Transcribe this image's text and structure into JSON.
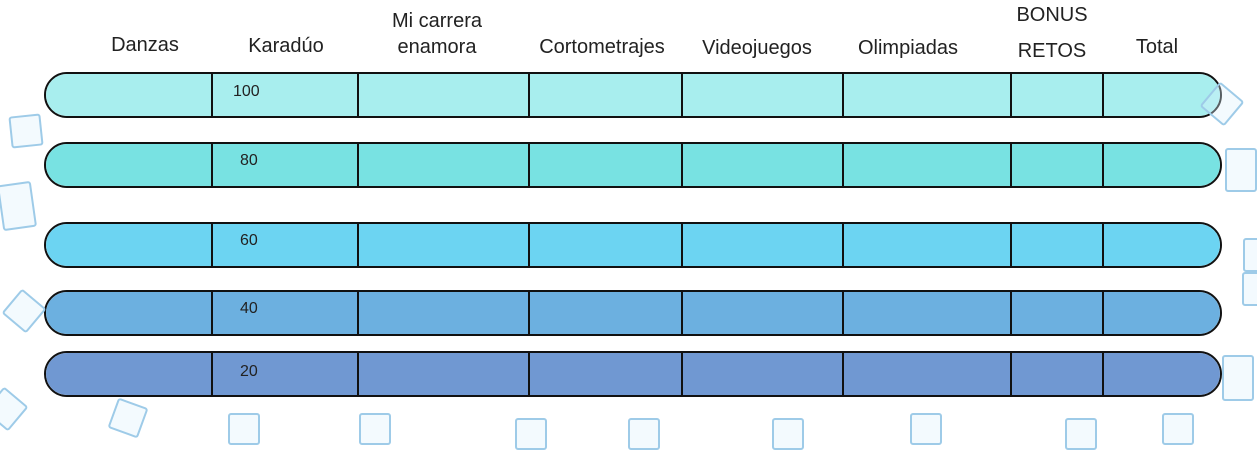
{
  "headers": [
    {
      "key": "danzas",
      "lines": [
        "Danzas"
      ]
    },
    {
      "key": "karaduo",
      "lines": [
        "Karadúo"
      ]
    },
    {
      "key": "mi-carrera",
      "lines": [
        "Mi carrera",
        "enamora"
      ]
    },
    {
      "key": "cortometrajes",
      "lines": [
        "Cortometrajes"
      ]
    },
    {
      "key": "videojuegos",
      "lines": [
        "Videojuegos"
      ]
    },
    {
      "key": "olimpiadas",
      "lines": [
        "Olimpiadas"
      ]
    },
    {
      "key": "bonus-retos",
      "lines": [
        "BONUS",
        "RETOS"
      ]
    },
    {
      "key": "total",
      "lines": [
        "Total"
      ]
    }
  ],
  "rows": [
    {
      "label": "100",
      "color": "#a8eeee"
    },
    {
      "label": "80",
      "color": "#78e2e2"
    },
    {
      "label": "60",
      "color": "#6cd4f2"
    },
    {
      "label": "40",
      "color": "#6cb0e0"
    },
    {
      "label": "20",
      "color": "#7098d2"
    }
  ],
  "colors": {
    "border": "#111111",
    "deco": "#9ecbe8"
  }
}
